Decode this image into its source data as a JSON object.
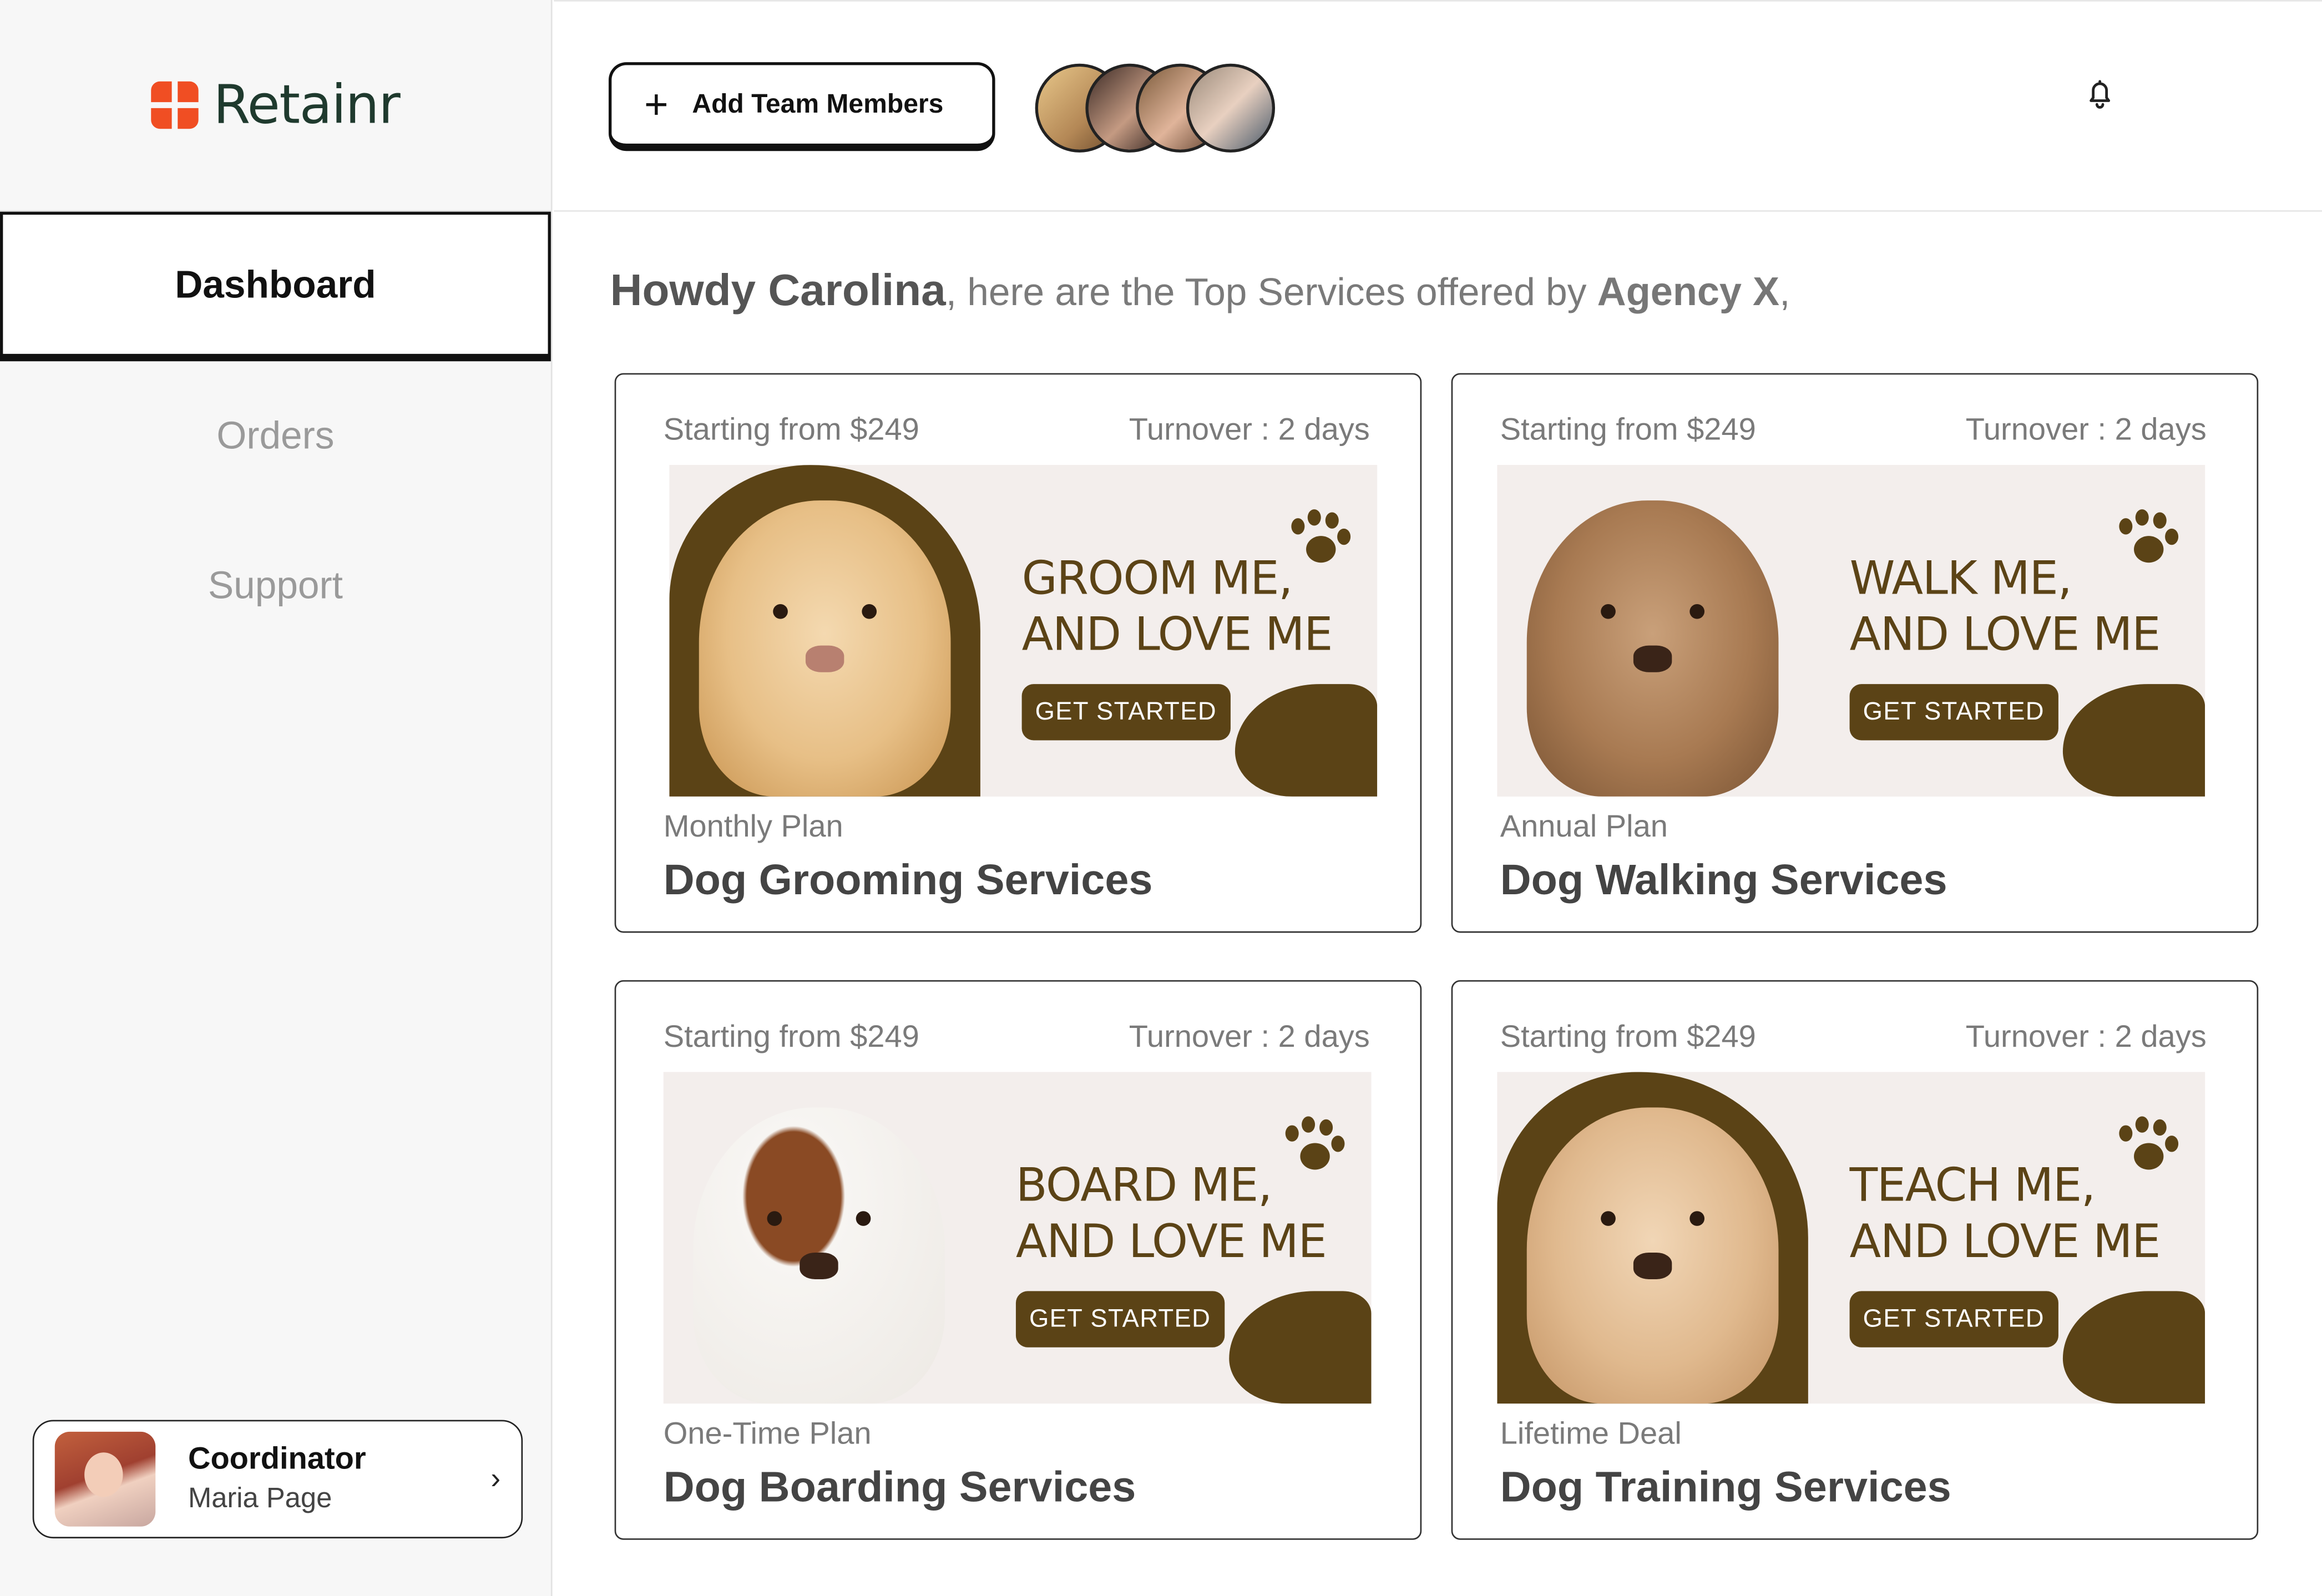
{
  "app": {
    "name": "Retainr"
  },
  "sidebar": {
    "items": [
      {
        "label": "Dashboard",
        "active": true
      },
      {
        "label": "Orders",
        "active": false
      },
      {
        "label": "Support",
        "active": false
      }
    ],
    "profile": {
      "role": "Coordinator",
      "name": "Maria Page"
    }
  },
  "header": {
    "add_button_label": "Add Team Members",
    "team_avatar_count": 4
  },
  "greeting": {
    "name": "Howdy Carolina",
    "middle": ", here are the Top Services offered by ",
    "agency": "Agency X",
    "end": ","
  },
  "services": [
    {
      "price": "Starting from $249",
      "turnover": "Turnover : 2 days",
      "slogan_1": "GROOM ME,",
      "slogan_2": "AND LOVE ME",
      "cta": "GET STARTED",
      "plan": "Monthly Plan",
      "title": "Dog Grooming Services"
    },
    {
      "price": "Starting from $249",
      "turnover": "Turnover : 2 days",
      "slogan_1": "WALK ME,",
      "slogan_2": "AND LOVE ME",
      "cta": "GET STARTED",
      "plan": "Annual Plan",
      "title": "Dog Walking Services"
    },
    {
      "price": "Starting from $249",
      "turnover": "Turnover : 2 days",
      "slogan_1": "BOARD ME,",
      "slogan_2": "AND LOVE ME",
      "cta": "GET STARTED",
      "plan": "One-Time Plan",
      "title": "Dog Boarding Services"
    },
    {
      "price": "Starting from $249",
      "turnover": "Turnover : 2 days",
      "slogan_1": "TEACH ME,",
      "slogan_2": "AND LOVE ME",
      "cta": "GET STARTED",
      "plan": "Lifetime Deal",
      "title": "Dog Training Services"
    }
  ],
  "colors": {
    "brand": "#f04e23",
    "banner_brown": "#5b4316",
    "banner_bg": "#f3eeec"
  }
}
